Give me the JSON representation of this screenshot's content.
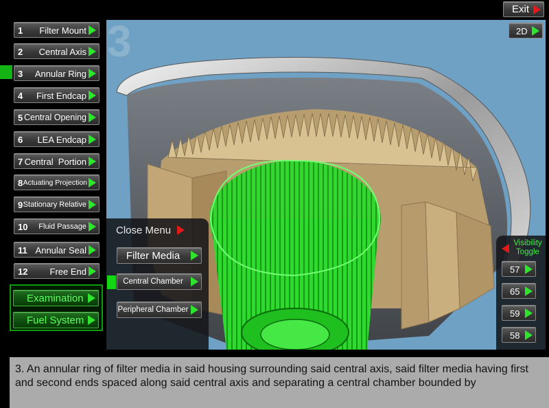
{
  "menu": {
    "items": [
      {
        "num": "1",
        "label": "Filter Mount"
      },
      {
        "num": "2",
        "label": "Central Axis"
      },
      {
        "num": "3",
        "label": "Annular Ring"
      },
      {
        "num": "4",
        "label": "First Endcap"
      },
      {
        "num": "5",
        "label": "Central Opening"
      },
      {
        "num": "6",
        "label": "LEA Endcap"
      },
      {
        "num": "7",
        "label": "Central  Portion"
      },
      {
        "num": "8",
        "label": "Actuating Projection"
      },
      {
        "num": "9",
        "label": "Stationary Relative"
      },
      {
        "num": "10",
        "label": "Fluid Passage"
      },
      {
        "num": "11",
        "label": "Annular Seal"
      },
      {
        "num": "12",
        "label": "Free End"
      }
    ],
    "active_index": 3
  },
  "modes": {
    "examination": "Examination",
    "fuel_system": "Fuel System"
  },
  "viewport": {
    "step_number": "3"
  },
  "toolbar": {
    "exit_label": "Exit",
    "view_2d_label": "2D"
  },
  "submenu": {
    "close_label": "Close Menu",
    "items": [
      {
        "label": "Filter Media"
      },
      {
        "label": "Central Chamber"
      },
      {
        "label": "Peripheral Chamber"
      }
    ]
  },
  "visibility": {
    "label": "Visibility Toggle",
    "items": [
      "57",
      "65",
      "59",
      "58"
    ]
  },
  "description": "3. An annular ring of filter media in said housing surrounding said central axis, said filter media having first and second ends spaced along said central axis and separating a central chamber bounded by",
  "colors": {
    "accent_green": "#2ee52e",
    "accent_red": "#e01a1a",
    "viewport_bg": "#6fa1c4"
  }
}
